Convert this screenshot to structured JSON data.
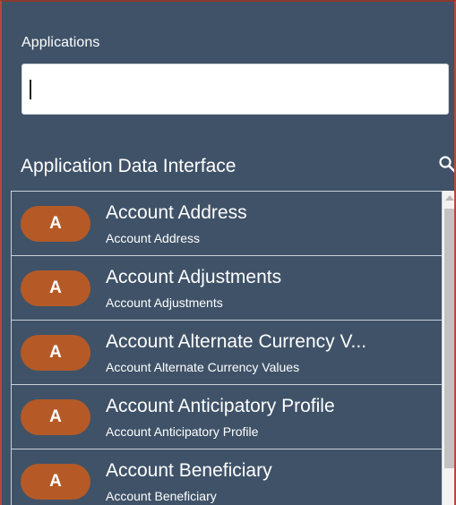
{
  "applications": {
    "label": "Applications",
    "input_value": ""
  },
  "section": {
    "title": "Application Data Interface",
    "search_icon": "search-icon"
  },
  "list": {
    "items": [
      {
        "badge": "A",
        "title": "Account Address",
        "subtitle": "Account Address"
      },
      {
        "badge": "A",
        "title": "Account Adjustments",
        "subtitle": "Account Adjustments"
      },
      {
        "badge": "A",
        "title": "Account Alternate Currency V...",
        "subtitle": "Account Alternate Currency Values"
      },
      {
        "badge": "A",
        "title": "Account Anticipatory Profile",
        "subtitle": "Account Anticipatory Profile"
      },
      {
        "badge": "A",
        "title": "Account Beneficiary",
        "subtitle": "Account Beneficiary"
      }
    ]
  },
  "colors": {
    "panel_background": "#3f5268",
    "badge_background": "#b55a26",
    "divider": "#c9d1da"
  }
}
